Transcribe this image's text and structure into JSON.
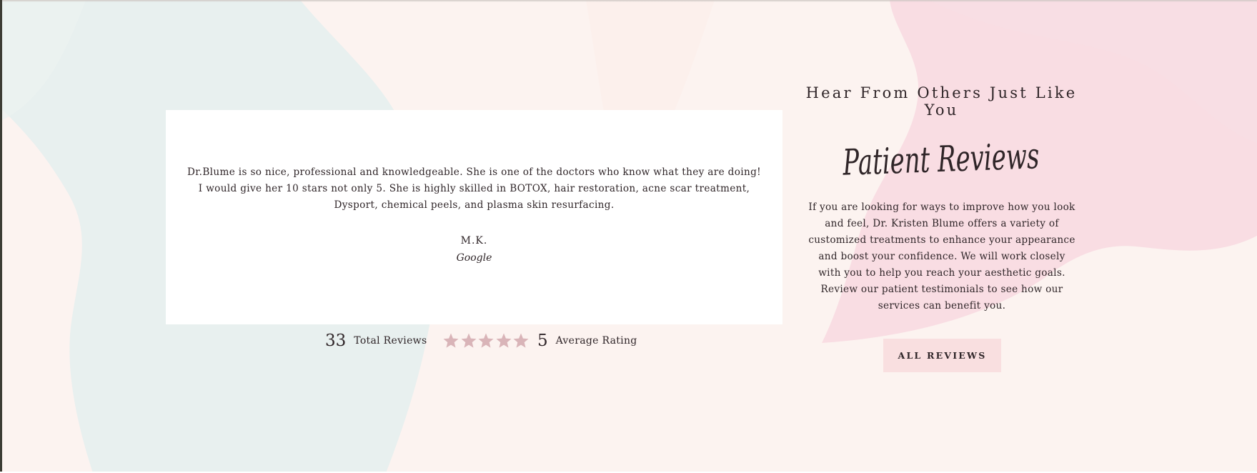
{
  "colors": {
    "page_background": "#fcf3f0",
    "card_background": "#ffffff",
    "text": "#2f2528",
    "star": "#d9b4b8",
    "button_background": "#f9dfe0",
    "wash_blue": "#e4eeee",
    "wash_pink": "#f8d6df"
  },
  "review": {
    "quote": "Dr.Blume is so nice, professional and knowledgeable. She is one of the doctors who know what they are doing! I would give her 10 stars not only 5. She is highly skilled in BOTOX, hair restoration, acne scar treatment, Dysport, chemical peels, and plasma skin resurfacing.",
    "author": "M.K.",
    "source": "Google"
  },
  "stats": {
    "total_reviews": "33",
    "total_reviews_label": "Total Reviews",
    "stars_filled": 5,
    "stars_total": 5,
    "star_icon": "star-icon",
    "average_rating": "5",
    "average_rating_label": "Average Rating"
  },
  "intro": {
    "eyebrow": "Hear From Others Just Like You",
    "title": "Patient Reviews",
    "body": "If you are looking for ways to improve how you look and feel, Dr. Kristen Blume offers a variety of customized treatments to enhance your appearance and boost your confidence. We will work closely with you to help you reach your aesthetic goals. Review our patient testimonials to see how our services can benefit you."
  },
  "button": {
    "label": "ALL REVIEWS"
  }
}
